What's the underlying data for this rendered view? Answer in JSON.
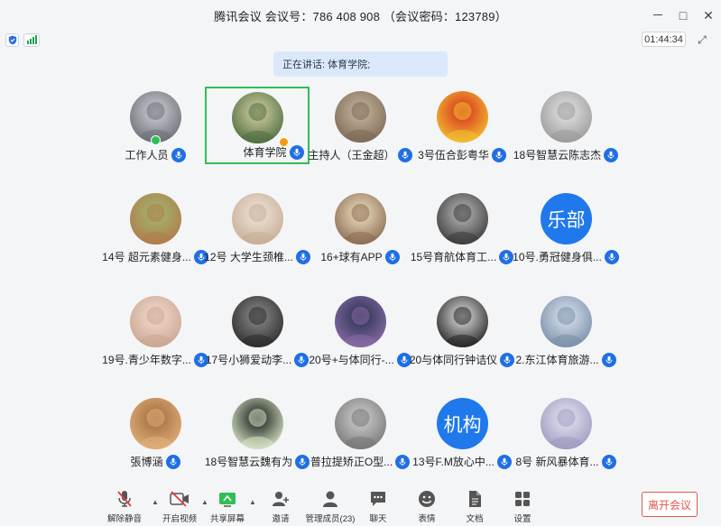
{
  "window": {
    "title": "腾讯会议 会议号：786 408 908 （会议密码：123789）",
    "minimize_glyph": "－",
    "maximize_glyph": "□",
    "close_glyph": "✕"
  },
  "status": {
    "timer": "01:44:34",
    "signal_color": "#21a14b",
    "expand_glyph": "⤢"
  },
  "speaking": {
    "text": "正在讲话: 体育学院;"
  },
  "participants": [
    {
      "name": "工作人员"
    },
    {
      "name": "体育学院"
    },
    {
      "name": "主持人（王金超）"
    },
    {
      "name": "3号伍合彭粤华"
    },
    {
      "name": "18号智慧云陈志杰"
    },
    {
      "name": "14号 超元素健身..."
    },
    {
      "name": "12号 大学生颈椎..."
    },
    {
      "name": "16+球有APP"
    },
    {
      "name": "15号育航体育工..."
    },
    {
      "name": "10号.勇冠健身俱...",
      "avatar_text": "乐部"
    },
    {
      "name": "19号.青少年数字..."
    },
    {
      "name": "17号小狮爱动李..."
    },
    {
      "name": "20号+与体同行-..."
    },
    {
      "name": "20与体同行钟诘仪"
    },
    {
      "name": "2.东江体育旅游..."
    },
    {
      "name": "張博涵"
    },
    {
      "name": "18号智慧云魏有为"
    },
    {
      "name": "普拉提矫正O型..."
    },
    {
      "name": "13号F.M放心中...",
      "avatar_text": "机构"
    },
    {
      "name": "8号 新风暴体育..."
    }
  ],
  "toolbar": {
    "unmute": "解除静音",
    "video": "开启视频",
    "share": "共享屏幕",
    "invite": "邀请",
    "members": "管理成员(23)",
    "chat": "聊天",
    "reaction": "表情",
    "docs": "文档",
    "settings": "设置",
    "leave": "离开会议",
    "caret_glyph": "▲"
  },
  "colors": {
    "accent": "#1f6fe5",
    "active_border": "#2fbf55",
    "leave": "#e2574c"
  }
}
